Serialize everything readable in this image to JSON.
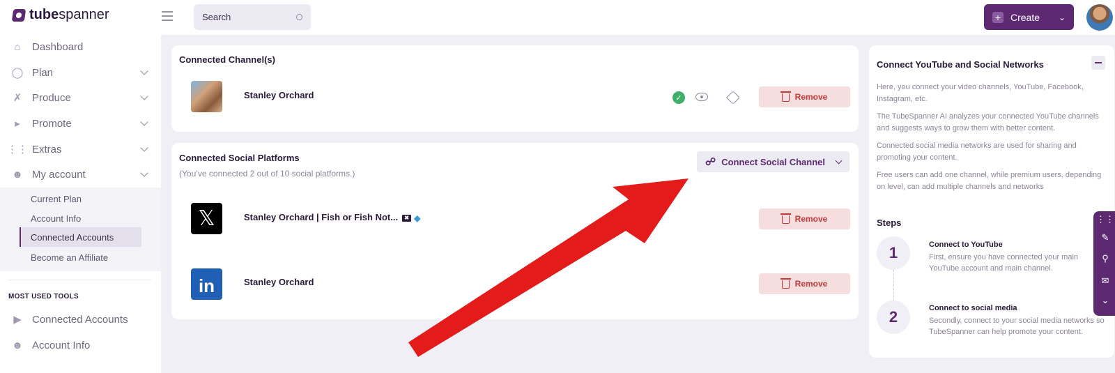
{
  "brand": {
    "bold": "tube",
    "light": "spanner"
  },
  "search": {
    "placeholder": "Search"
  },
  "create": {
    "label": "Create"
  },
  "sidebar": {
    "items": [
      {
        "label": "Dashboard",
        "icon": "home-icon"
      },
      {
        "label": "Plan",
        "icon": "bulb-icon"
      },
      {
        "label": "Produce",
        "icon": "tools-icon"
      },
      {
        "label": "Promote",
        "icon": "megaphone-icon"
      },
      {
        "label": "Extras",
        "icon": "grid-icon"
      },
      {
        "label": "My account",
        "icon": "user-gear-icon"
      }
    ],
    "submenu": [
      {
        "label": "Current Plan"
      },
      {
        "label": "Account Info"
      },
      {
        "label": "Connected Accounts"
      },
      {
        "label": "Become an Affiliate"
      }
    ],
    "tools_title": "MOST USED TOOLS",
    "tools": [
      {
        "label": "Connected Accounts",
        "icon": "youtube-icon"
      },
      {
        "label": "Account Info",
        "icon": "user-gear-icon"
      }
    ]
  },
  "channels": {
    "title": "Connected Channel(s)",
    "items": [
      {
        "name": "Stanley Orchard",
        "remove": "Remove"
      }
    ]
  },
  "social": {
    "title": "Connected Social Platforms",
    "note": "(You’ve connected 2 out of 10 social platforms.)",
    "connect_label": "Connect Social Channel",
    "items": [
      {
        "name": "Stanley Orchard | Fish or Fish Not...",
        "platform": "X",
        "remove": "Remove"
      },
      {
        "name": "Stanley Orchard",
        "platform": "LinkedIn",
        "remove": "Remove"
      }
    ]
  },
  "help": {
    "title": "Connect YouTube and Social Networks",
    "paragraphs": [
      "Here, you connect your video channels, YouTube, Facebook, Instagram, etc.",
      "The TubeSpanner AI analyzes your connected YouTube channels and suggests ways to grow them with better content.",
      "Connected social media networks are used for sharing and promoting your content.",
      "Free users can add one channel, while premium users, depending on level, can add multiple channels and networks"
    ],
    "steps_title": "Steps",
    "steps": [
      {
        "num": "1",
        "title": "Connect to YouTube",
        "text": "First, ensure you have connected your main YouTube account and main channel."
      },
      {
        "num": "2",
        "title": "Connect to social media",
        "text": "Secondly, connect to your social media networks so TubeSpanner can help promote your content."
      }
    ]
  },
  "colors": {
    "brand": "#5d2a72",
    "remove_bg": "#f6dede",
    "remove_text": "#c43a3a",
    "arrow": "#e31b1b",
    "verified": "#3fb06b"
  }
}
